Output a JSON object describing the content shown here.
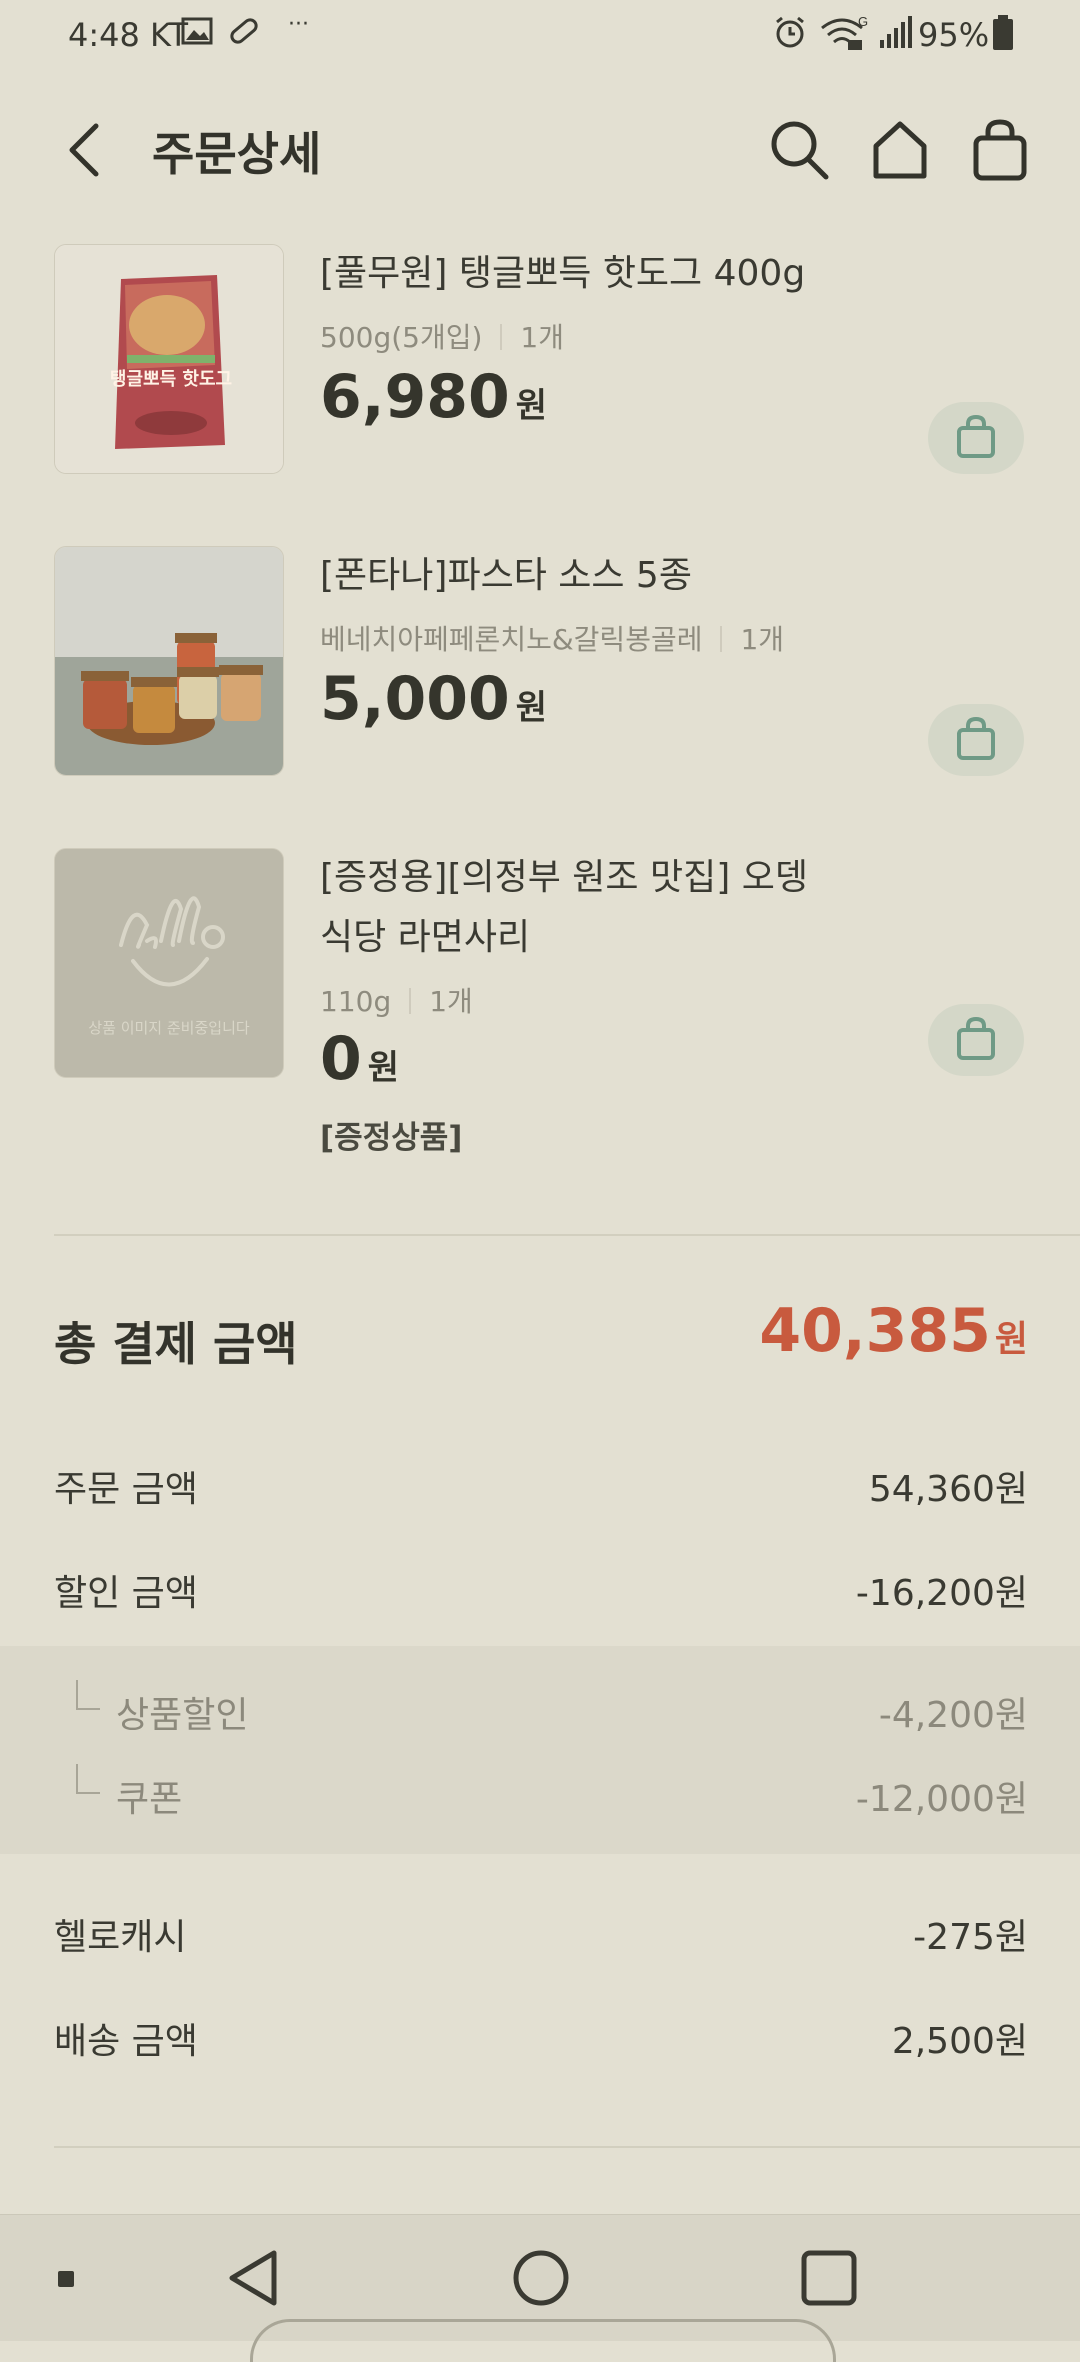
{
  "status_bar": {
    "time": "4:48",
    "carrier": "KT",
    "more": "···",
    "battery_percent": "95%"
  },
  "header": {
    "title": "주문상세"
  },
  "items": [
    {
      "name": "[풀무원] 탱글뽀득 핫도그 400g",
      "option": "500g(5개입)",
      "qty": "1개",
      "price": "6,980",
      "currency": "원",
      "thumb_text": "탱글뽀득 핫도그"
    },
    {
      "name": "[폰타나]파스타 소스 5종",
      "option": "베네치아페페론치노&갈릭봉골레",
      "qty": "1개",
      "price": "5,000",
      "currency": "원"
    },
    {
      "name": "[증정용][의정부 원조 맛집] 오뎅식당 라면사리",
      "option": "110g",
      "qty": "1개",
      "price": "0",
      "currency": "원",
      "badge": "[증정상품]",
      "thumb_text": "상품 이미지 준비중입니다"
    }
  ],
  "summary": {
    "total_label": "총 결제 금액",
    "total_value": "40,385",
    "total_currency": "원",
    "order_label": "주문 금액",
    "order_value": "54,360원",
    "discount_label": "할인 금액",
    "discount_value": "-16,200원",
    "product_discount_label": "상품할인",
    "product_discount_value": "-4,200원",
    "coupon_label": "쿠폰",
    "coupon_value": "-12,000원",
    "cash_label": "헬로캐시",
    "cash_value": "-275원",
    "shipping_label": "배송 금액",
    "shipping_value": "2,500원"
  },
  "colors": {
    "background": "#e3e0d2",
    "accent_price": "#c85a3e",
    "cart_icon": "#6f9a86"
  }
}
